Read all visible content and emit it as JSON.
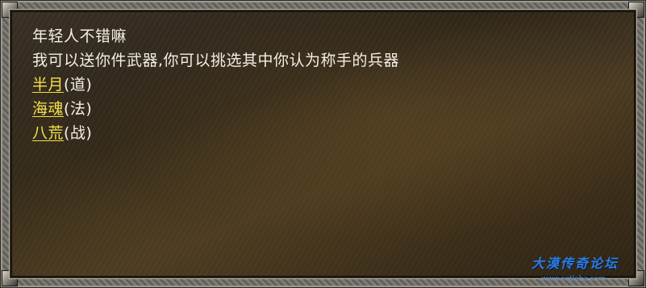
{
  "dialog": {
    "lines": [
      "年轻人不错嘛",
      "我可以送你件武器,你可以挑选其中你认为称手的兵器"
    ],
    "options": [
      {
        "name": "半月",
        "class": "(道)"
      },
      {
        "name": "海魂",
        "class": "(法)"
      },
      {
        "name": "八荒",
        "class": "(战)"
      }
    ]
  },
  "watermark": {
    "title": "大漠传奇论坛",
    "url": "www.cqtleba.com"
  },
  "colors": {
    "text": "#f3efe6",
    "link": "#f4e04a",
    "watermark": "#2d7de0"
  }
}
